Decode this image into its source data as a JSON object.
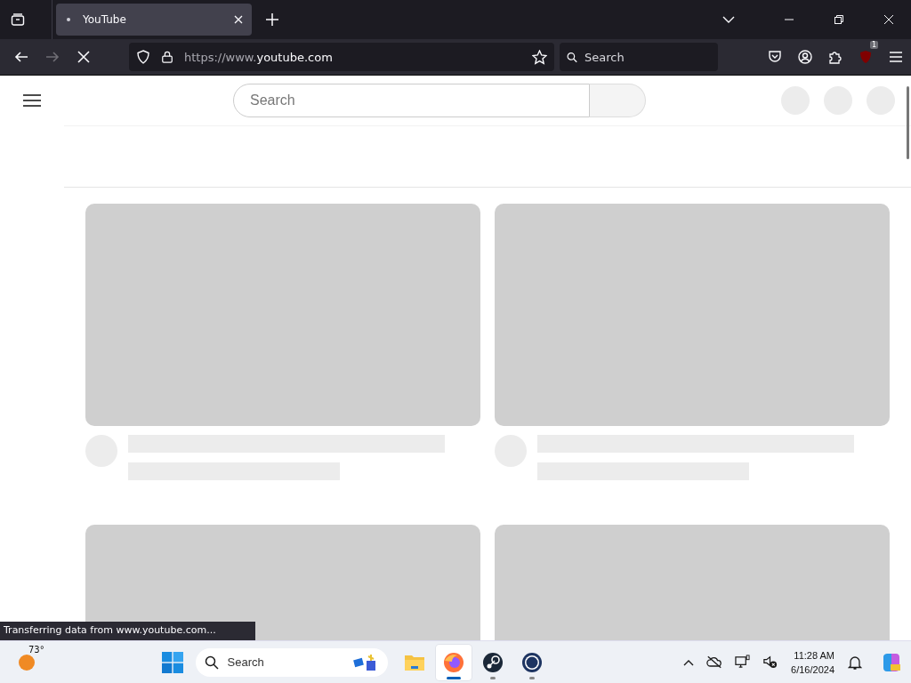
{
  "browser": {
    "tabs": [
      {
        "title": "YouTube",
        "selected": true
      }
    ],
    "url_prefix": "https://www.",
    "url_domain": "youtube.com",
    "loading": true,
    "search_placeholder": "Search",
    "extension_badge": "1"
  },
  "page": {
    "search_placeholder": "Search",
    "cards": [
      {
        "kind": "video_skeleton"
      },
      {
        "kind": "video_skeleton"
      },
      {
        "kind": "thumbnail_skeleton"
      },
      {
        "kind": "thumbnail_skeleton"
      }
    ]
  },
  "status": "Transferring data from www.youtube.com...",
  "taskbar": {
    "weather": "73°",
    "search_placeholder": "Search",
    "time": "11:28 AM",
    "date": "6/16/2024",
    "apps": [
      {
        "kind": "files",
        "running": false,
        "selected": false
      },
      {
        "kind": "firefox",
        "running": true,
        "selected": true
      },
      {
        "kind": "steam",
        "running": true,
        "selected": false
      },
      {
        "kind": "vr",
        "running": true,
        "selected": false
      }
    ]
  }
}
